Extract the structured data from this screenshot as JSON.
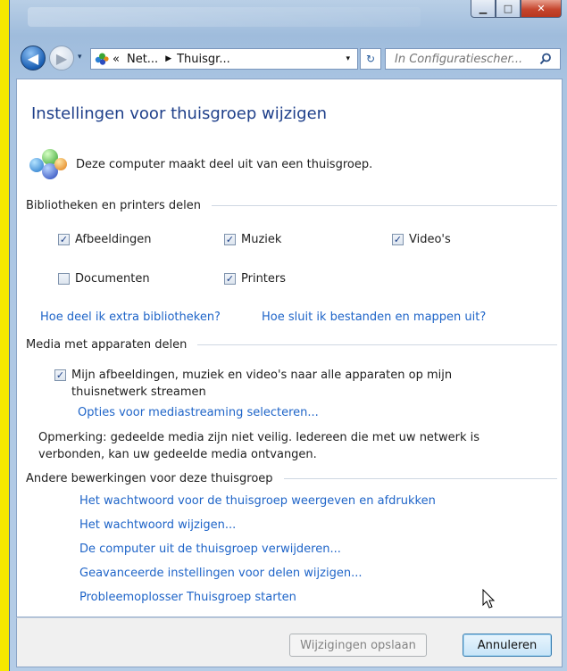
{
  "window": {
    "minimize_glyph": "▁",
    "maximize_glyph": "□",
    "close_glyph": "✕"
  },
  "navbar": {
    "back_glyph": "◀",
    "forward_glyph": "▶",
    "history_glyph": "▾",
    "address_overflow": "«",
    "breadcrumb": [
      "Net...",
      "Thuisgr..."
    ],
    "separator_glyph": "▶",
    "address_dropdown_glyph": "▾",
    "refresh_glyph": "↻",
    "search_placeholder": "In Configuratiescher...",
    "search_icon": "search-icon"
  },
  "page": {
    "title": "Instellingen voor thuisgroep wijzigen",
    "homegroup_status": "Deze computer maakt deel uit van een thuisgroep.",
    "homegroup_icon": "homegroup-icon"
  },
  "libraries": {
    "heading": "Bibliotheken en printers delen",
    "items": [
      {
        "label": "Afbeeldingen",
        "checked": true
      },
      {
        "label": "Muziek",
        "checked": true
      },
      {
        "label": "Video's",
        "checked": true
      },
      {
        "label": "Documenten",
        "checked": false
      },
      {
        "label": "Printers",
        "checked": true
      }
    ],
    "link_extra": "Hoe deel ik extra bibliotheken?",
    "link_exclude": "Hoe sluit ik bestanden en mappen uit?"
  },
  "media": {
    "heading": "Media met apparaten delen",
    "stream_label": "Mijn afbeeldingen, muziek en video's naar alle apparaten op mijn thuisnetwerk streamen",
    "stream_checked": true,
    "options_link": "Opties voor mediastreaming selecteren...",
    "note": "Opmerking: gedeelde media zijn niet veilig. Iedereen die met uw netwerk is verbonden, kan uw gedeelde media ontvangen."
  },
  "other": {
    "heading": "Andere bewerkingen voor deze thuisgroep",
    "links": [
      "Het wachtwoord voor de thuisgroep weergeven en afdrukken",
      "Het wachtwoord wijzigen...",
      "De computer uit de thuisgroep verwijderen...",
      "Geavanceerde instellingen voor delen wijzigen...",
      "Probleemoplosser Thuisgroep starten"
    ]
  },
  "footer": {
    "save_label": "Wijzigingen opslaan",
    "save_enabled": false,
    "cancel_label": "Annuleren"
  },
  "check_glyph": "✓",
  "colors": {
    "link": "#1e64c8",
    "title": "#1e3f8a",
    "frame": "#f5e800"
  }
}
